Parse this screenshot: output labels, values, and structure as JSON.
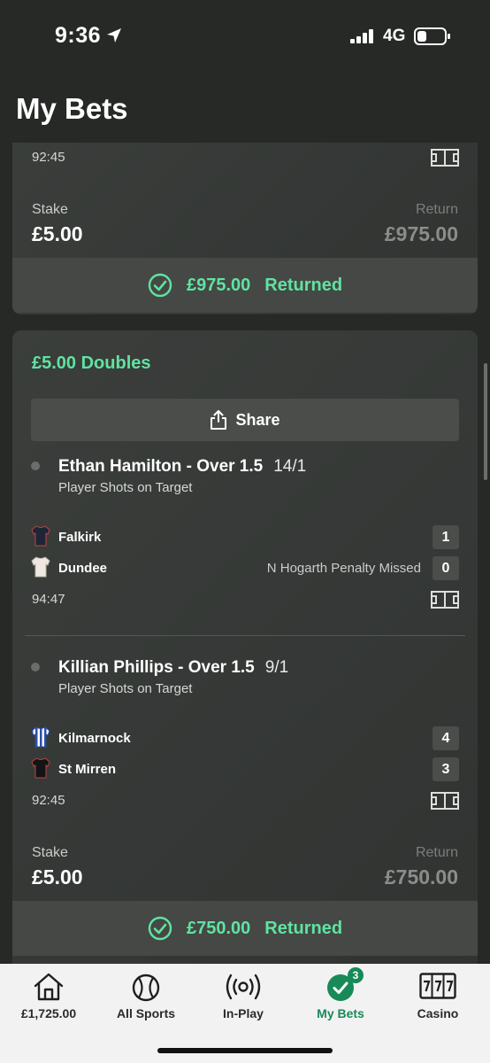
{
  "status_bar": {
    "time": "9:36",
    "network": "4G"
  },
  "page": {
    "title": "My Bets"
  },
  "bets": [
    {
      "match_time": "92:45",
      "stake_label": "Stake",
      "stake": "£5.00",
      "return_label": "Return",
      "return": "£975.00",
      "returned_amount": "£975.00",
      "returned_text": "Returned"
    },
    {
      "bet_type": "£5.00 Doubles",
      "share_label": "Share",
      "selections": [
        {
          "title": "Ethan Hamilton - Over 1.5",
          "odds": "14/1",
          "market": "Player Shots on Target",
          "home_team": "Falkirk",
          "home_score": "1",
          "away_team": "Dundee",
          "away_score": "0",
          "event": "N Hogarth Penalty Missed",
          "match_time": "94:47"
        },
        {
          "title": "Killian Phillips - Over 1.5",
          "odds": "9/1",
          "market": "Player Shots on Target",
          "home_team": "Kilmarnock",
          "home_score": "4",
          "away_team": "St Mirren",
          "away_score": "3",
          "match_time": "92:45"
        }
      ],
      "stake_label": "Stake",
      "stake": "£5.00",
      "return_label": "Return",
      "return": "£750.00",
      "returned_amount": "£750.00",
      "returned_text": "Returned"
    }
  ],
  "bottom_nav": {
    "items": [
      {
        "label": "£1,725.00",
        "icon": "home-icon"
      },
      {
        "label": "All Sports",
        "icon": "ball-icon"
      },
      {
        "label": "In-Play",
        "icon": "broadcast-icon"
      },
      {
        "label": "My Bets",
        "icon": "check-circle-icon",
        "badge": "3",
        "active": true
      },
      {
        "label": "Casino",
        "icon": "slot-machine-icon"
      }
    ]
  },
  "colors": {
    "background": "#272927",
    "card": "#383b39",
    "accent_green": "#5fe3a1",
    "nav_active": "#178a57",
    "nav_background": "#f2f2f2"
  }
}
